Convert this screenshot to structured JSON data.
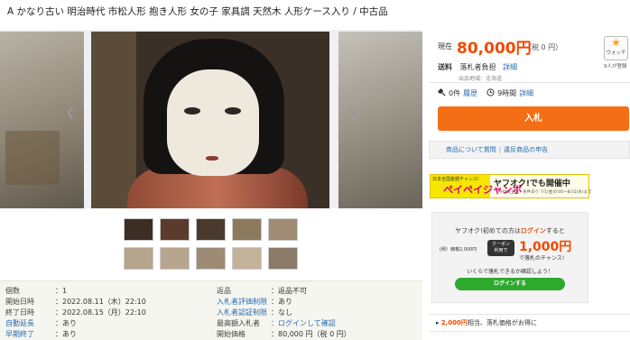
{
  "title": "A かなり古い 明治時代 市松人形 抱き人形 女の子 家具調 天然木 人形ケース入り / 中古品",
  "gallery": {
    "prev_icon": "chevron-left-icon",
    "next_icon": "chevron-right-icon",
    "thumbnail_count": 10
  },
  "info": {
    "left": [
      {
        "label": "個数",
        "value": "：1",
        "label_link": false,
        "value_link": false
      },
      {
        "label": "開始日時",
        "value": "：2022.08.11（木）22:10",
        "label_link": false,
        "value_link": false
      },
      {
        "label": "終了日時",
        "value": "：2022.08.15（月）22:10",
        "label_link": false,
        "value_link": false
      },
      {
        "label": "自動延長",
        "value": "：あり",
        "label_link": true,
        "value_link": false
      },
      {
        "label": "早期終了",
        "value": "：あり",
        "label_link": true,
        "value_link": false
      }
    ],
    "right": [
      {
        "label": "返品",
        "value": "：返品不可",
        "label_link": false,
        "value_link": false
      },
      {
        "label": "入札者評価制限",
        "value": "：あり",
        "label_link": true,
        "value_link": false
      },
      {
        "label": "入札者認証制限",
        "value": "：なし",
        "label_link": true,
        "value_link": false
      },
      {
        "label": "最高額入札者",
        "value": "：ログインして確認",
        "label_link": false,
        "value_link": true
      },
      {
        "label": "開始価格",
        "value": "：80,000 円（税 0 円）",
        "label_link": false,
        "value_link": false
      }
    ]
  },
  "price": {
    "label": "現在",
    "amount": "80,000円",
    "tax": "（税 0 円）"
  },
  "watch": {
    "label": "ウォッチ",
    "count": "9人が登録",
    "icon": "star-icon"
  },
  "shipping": {
    "label": "送料",
    "value": "落札者負担",
    "detail": "詳細",
    "from": "出品地域：北海道"
  },
  "stats": {
    "bids": "0件",
    "history": "履歴",
    "time": "9時間",
    "detail": "詳細"
  },
  "bid_button": "入札",
  "qa": {
    "question": "商品について質問",
    "report": "違反商品の申告",
    "separator": "|"
  },
  "banner": {
    "small": "日本全国金額チャンス!",
    "jumbo": "ペイペイジャンボ",
    "right": "ヤフオク!でも開催中",
    "dates": "※付与上限・条件あり 7/1(金)0:00〜8/31(水)まで"
  },
  "promo": {
    "top_prefix": "ヤフオク!初めての方は",
    "top_login": "ログイン",
    "top_suffix": "すると",
    "left": "(例）価格2,000円",
    "coupon_top": "クーポン",
    "coupon_bottom": "利用で",
    "amount": "1,000円",
    "sub": "で落札のチャンス!",
    "ask": "いくらで落札できるか確認しよう！",
    "login_button": "ログインする"
  },
  "strip": {
    "amount": "2,000円",
    "text": "相当、落札価格がお得に"
  },
  "colors": {
    "accent": "#f46e15",
    "price": "#f14a00",
    "link": "#2b6cb0",
    "login": "#2ea92e"
  }
}
